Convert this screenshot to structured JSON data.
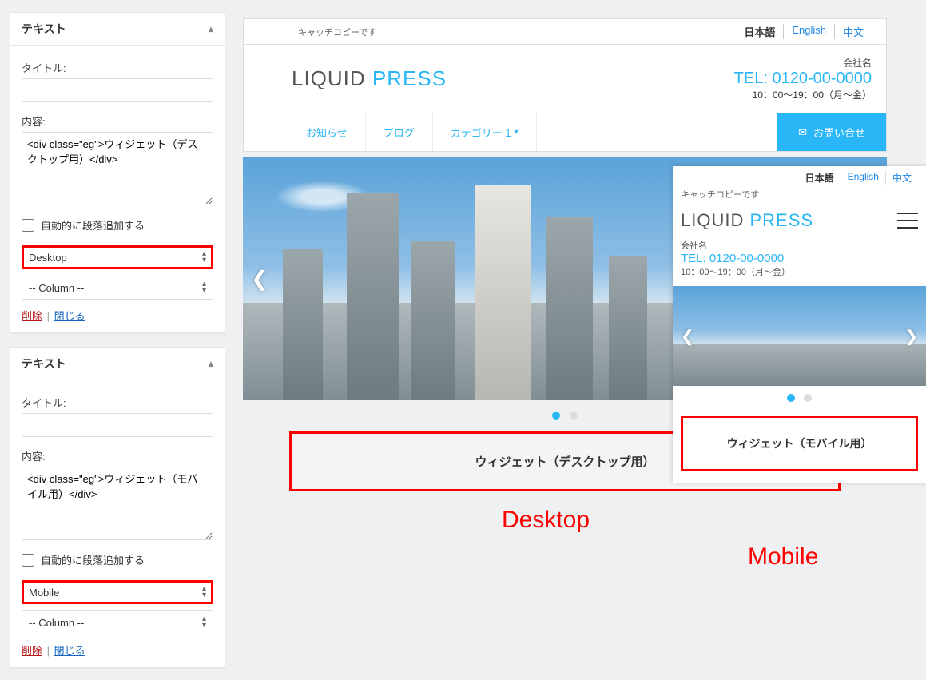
{
  "widget1": {
    "header": "テキスト",
    "title_label": "タイトル:",
    "title_value": "",
    "content_label": "内容:",
    "content_value": "<div class=\"eg\">ウィジェット（デスクトップ用）</div>",
    "autop_label": "自動的に段落追加する",
    "device_select": "Desktop",
    "column_select": "-- Column --",
    "delete": "削除",
    "close": "閉じる"
  },
  "widget2": {
    "header": "テキスト",
    "title_label": "タイトル:",
    "title_value": "",
    "content_label": "内容:",
    "content_value": "<div class=\"eg\">ウィジェット（モバイル用）</div>",
    "autop_label": "自動的に段落追加する",
    "device_select": "Mobile",
    "column_select": "-- Column --",
    "delete": "削除",
    "close": "閉じる"
  },
  "preview": {
    "catch_copy": "キャッチコピーです",
    "langs": {
      "jp": "日本語",
      "en": "English",
      "zh": "中文"
    },
    "logo_1": "LIQUID ",
    "logo_2": "PRESS",
    "company": "会社名",
    "tel": "TEL: 0120-00-0000",
    "hours": "10：00～19：00（月～金）",
    "nav": {
      "news": "お知らせ",
      "blog": "ブログ",
      "category": "カテゴリー 1",
      "contact": "お問い合せ"
    },
    "desktop_widget_text": "ウィジェット（デスクトップ用）",
    "mobile_widget_text": "ウィジェット（モバイル用）",
    "labels": {
      "desktop": "Desktop",
      "mobile": "Mobile"
    }
  }
}
